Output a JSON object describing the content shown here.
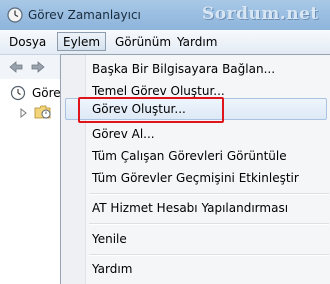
{
  "window": {
    "title": "Görev Zamanlayıcı",
    "watermark": "Sordum.net"
  },
  "menubar": {
    "items": [
      "Dosya",
      "Eylem",
      "Görünüm",
      "Yardım"
    ]
  },
  "tree": {
    "root_label": "Göre"
  },
  "dropdown": {
    "items": [
      "Başka Bir Bilgisayara Bağlan...",
      "Temel Görev Oluştur...",
      "Görev Oluştur...",
      "Görev Al...",
      "Tüm Çalışan Görevleri Görüntüle",
      "Tüm Görevler Geçmişini Etkinleştir",
      "AT Hizmet Hesabı Yapılandırması",
      "Yenile",
      "Yardım"
    ]
  },
  "colors": {
    "highlight_border": "#e0151c",
    "titlebar": "#9bbfe2"
  }
}
